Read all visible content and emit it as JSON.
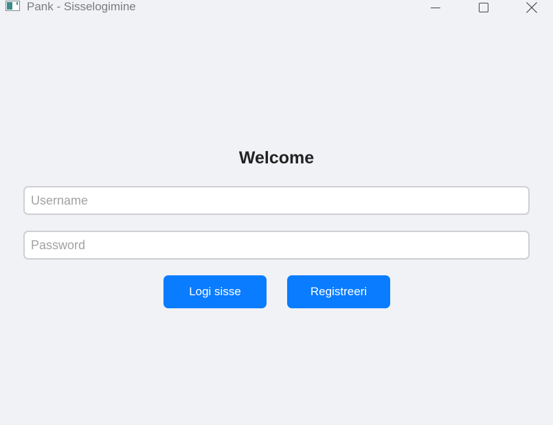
{
  "window": {
    "title": "Pank - Sisselogimine",
    "controls": [
      "minimize-icon",
      "maximize-icon",
      "close-icon"
    ]
  },
  "form": {
    "heading": "Welcome",
    "username": {
      "placeholder": "Username",
      "value": ""
    },
    "password": {
      "placeholder": "Password",
      "value": ""
    },
    "login_label": "Logi sisse",
    "register_label": "Registreeri"
  },
  "colors": {
    "background": "#f0f2f5",
    "accent": "#0a7cff",
    "field_border": "#cfcfd3",
    "heading_text": "#222222"
  }
}
